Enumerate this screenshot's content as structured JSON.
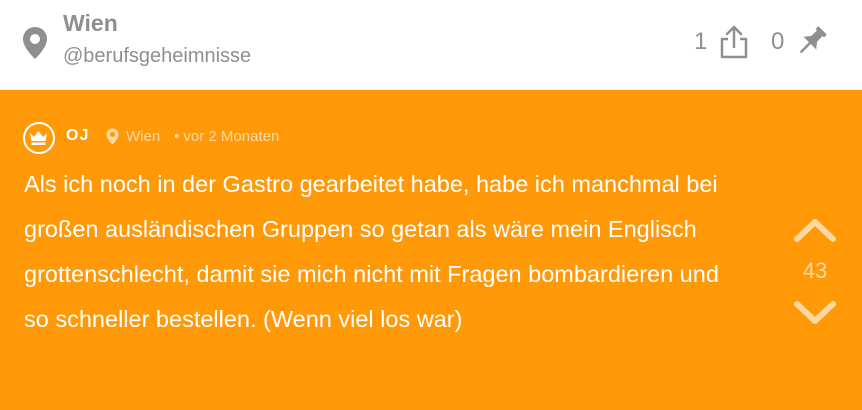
{
  "channel": {
    "title": "Wien",
    "handle": "@berufsgeheimnisse",
    "icon": "location-pin-icon"
  },
  "actions": {
    "share_count": "1",
    "share_icon": "share-icon",
    "pin_count": "0",
    "pin_icon": "pushpin-icon"
  },
  "post": {
    "author": "OJ",
    "badge_icon": "crown-icon",
    "location": "Wien",
    "time": "• vor 2 Monaten",
    "text": "Als ich noch in der Gastro gearbeitet habe, habe ich manchmal bei großen ausländischen Gruppen so getan als wäre mein Englisch grottenschlecht, damit sie mich nicht mit Fragen bombardieren und so schneller bestellen. (Wenn viel los war)",
    "votes": "43",
    "background_color": "#ff9908"
  }
}
